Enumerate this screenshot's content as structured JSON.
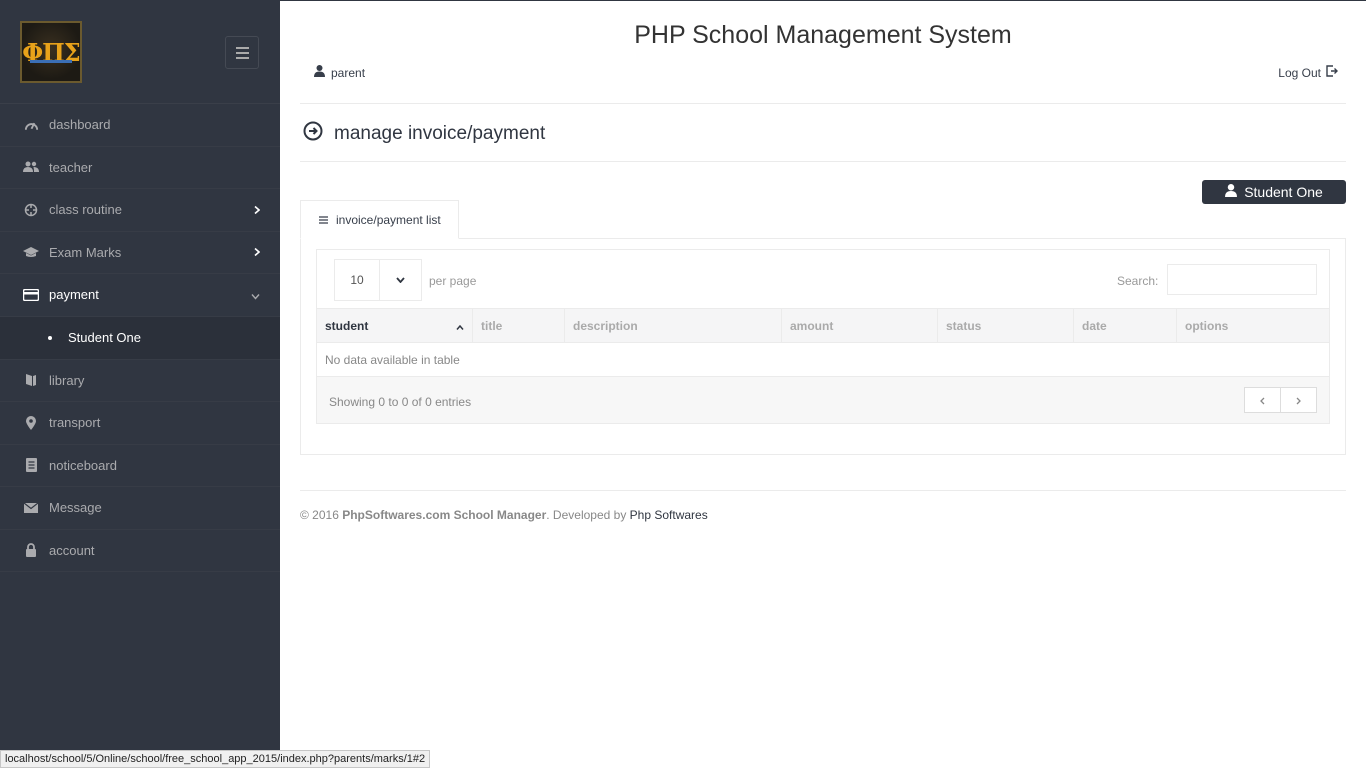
{
  "app": {
    "title": "PHP School Management System"
  },
  "logo": {
    "text": "ΦΠΣ"
  },
  "sidebar": {
    "items": [
      {
        "label": "dashboard",
        "icon": "dashboard-icon"
      },
      {
        "label": "teacher",
        "icon": "users-icon"
      },
      {
        "label": "class routine",
        "icon": "target-icon",
        "has_arrow": true
      },
      {
        "label": "Exam Marks",
        "icon": "graduation-cap-icon",
        "has_arrow": true
      },
      {
        "label": "payment",
        "icon": "credit-card-icon",
        "expanded": true
      },
      {
        "label": "library",
        "icon": "book-icon"
      },
      {
        "label": "transport",
        "icon": "location-icon"
      },
      {
        "label": "noticeboard",
        "icon": "document-icon"
      },
      {
        "label": "Message",
        "icon": "envelope-icon"
      },
      {
        "label": "account",
        "icon": "lock-icon"
      }
    ],
    "payment_sub": {
      "label": "Student One"
    }
  },
  "header": {
    "user": "parent",
    "logout": "Log Out"
  },
  "page": {
    "heading": "manage invoice/payment",
    "student_button": "Student One",
    "tab_label": "invoice/payment list"
  },
  "table": {
    "length_value": "10",
    "per_page": "per page",
    "search_label": "Search:",
    "columns": [
      "student",
      "title",
      "description",
      "amount",
      "status",
      "date",
      "options"
    ],
    "empty": "No data available in table",
    "info": "Showing 0 to 0 of 0 entries"
  },
  "footer": {
    "prefix": "© 2016 ",
    "brand": "PhpSoftwares.com School Manager",
    "middle": ". Developed by ",
    "link": "Php Softwares"
  },
  "statusbar": {
    "url": "localhost/school/5/Online/school/free_school_app_2015/index.php?parents/marks/1#2"
  },
  "colors": {
    "sidebar_bg": "#303641",
    "accent": "#303641"
  }
}
